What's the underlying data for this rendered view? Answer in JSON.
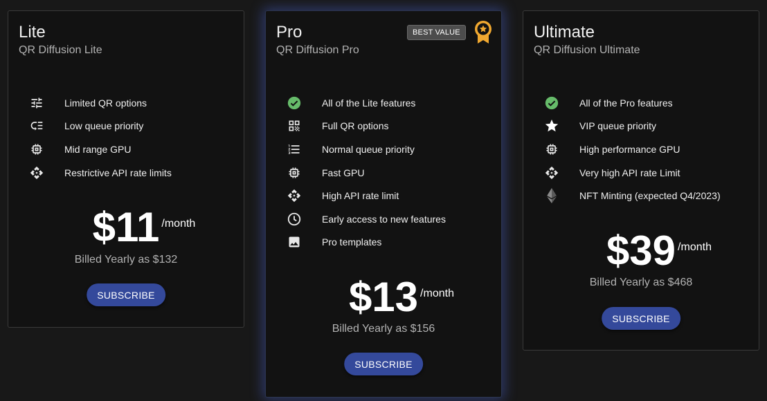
{
  "plans": [
    {
      "name": "Lite",
      "subtitle": "QR Diffusion Lite",
      "features": [
        {
          "icon": "tune-icon",
          "label": "Limited QR options"
        },
        {
          "icon": "low-priority-icon",
          "label": "Low queue priority"
        },
        {
          "icon": "chip-icon",
          "label": "Mid range GPU"
        },
        {
          "icon": "api-icon",
          "label": "Restrictive API rate limits"
        }
      ],
      "price": "$11",
      "per": "/month",
      "billed": "Billed Yearly as $132",
      "button": "SUBSCRIBE"
    },
    {
      "name": "Pro",
      "subtitle": "QR Diffusion Pro",
      "badge": "BEST VALUE",
      "award_icon": "award-ribbon-icon",
      "award_color": "#f0a830",
      "features": [
        {
          "icon": "check-circle-icon",
          "label": "All of the Lite features"
        },
        {
          "icon": "qr-code-icon",
          "label": "Full QR options"
        },
        {
          "icon": "numbered-list-icon",
          "label": "Normal queue priority"
        },
        {
          "icon": "chip-icon",
          "label": "Fast GPU"
        },
        {
          "icon": "api-icon",
          "label": "High API rate limit"
        },
        {
          "icon": "clock-icon",
          "label": "Early access to new features"
        },
        {
          "icon": "image-icon",
          "label": "Pro templates"
        }
      ],
      "price": "$13",
      "per": "/month",
      "billed": "Billed Yearly as $156",
      "button": "SUBSCRIBE"
    },
    {
      "name": "Ultimate",
      "subtitle": "QR Diffusion Ultimate",
      "features": [
        {
          "icon": "check-circle-icon",
          "label": "All of the Pro features"
        },
        {
          "icon": "star-icon",
          "label": "VIP queue priority"
        },
        {
          "icon": "chip-icon",
          "label": "High performance GPU"
        },
        {
          "icon": "api-icon",
          "label": "Very high API rate Limit"
        },
        {
          "icon": "ethereum-icon",
          "label": "NFT Minting (expected Q4/2023)"
        }
      ],
      "price": "$39",
      "per": "/month",
      "billed": "Billed Yearly as $468",
      "button": "SUBSCRIBE"
    }
  ],
  "colors": {
    "background": "#181818",
    "card": "#121212",
    "button": "#34499b",
    "check": "#66bb6a",
    "pro_glow": "#465fc8"
  }
}
